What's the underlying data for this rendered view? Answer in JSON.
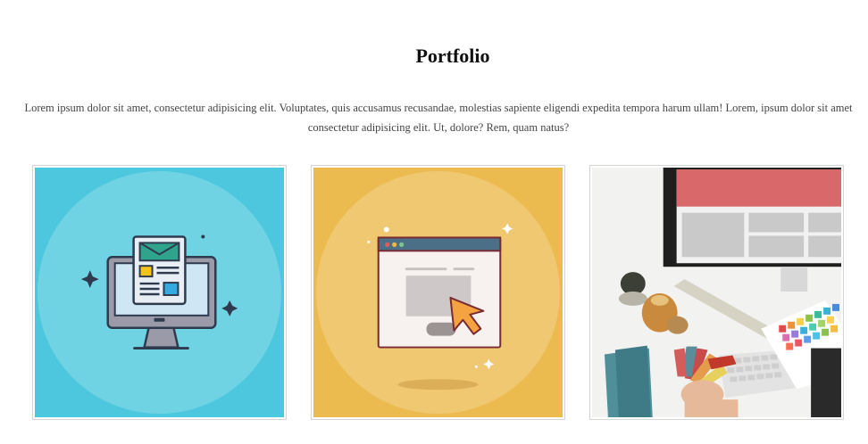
{
  "section": {
    "title": "Portfolio",
    "description": "Lorem ipsum dolor sit amet, consectetur adipisicing elit. Voluptates, quis accusamus recusandae, molestias sapiente eligendi expedita tempora harum ullam! Lorem, ipsum dolor sit amet consectetur adipisicing elit. Ut, dolore? Rem, quam natus?"
  },
  "portfolio_items": [
    {
      "icon": "web-design-icon",
      "background": "#4cc7de"
    },
    {
      "icon": "click-browser-icon",
      "background": "#ecbb50"
    },
    {
      "icon": "workspace-photo",
      "background": "#ededed"
    }
  ],
  "colors": {
    "teal": "#4cc7de",
    "yellow": "#ecbb50",
    "red_screen": "#d9686a"
  }
}
